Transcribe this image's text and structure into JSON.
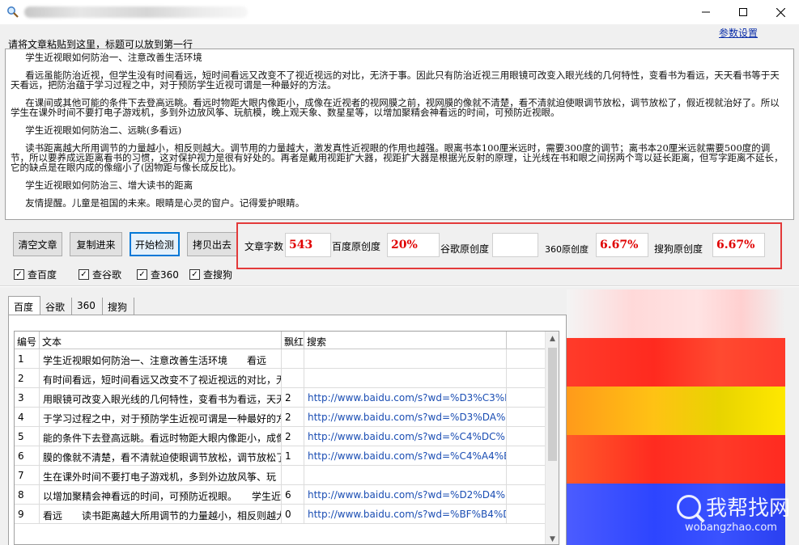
{
  "window": {
    "app_icon": "magnifier-icon",
    "min_label": "—",
    "max_label": "☐",
    "close_label": "✕"
  },
  "params_link": "参数设置",
  "paste_hint": "请将文章粘贴到这里，标题可以放到第一行",
  "article": {
    "p1": "     学生近视眼如何防治一、注意改善生活环境",
    "p2": "     看远虽能防治近视，但学生没有时间看远，短时间看远又改变不了视近视远的对比，无济于事。因此只有防治近视三用眼镜可改变入眼光线的几何特性，变看书为看远，天天看书等于天天看远，把防治蕴于学习过程之中，对于预防学生近视可谓是一种最好的方法。",
    "p3": "     在课间或其他可能的条件下去登高远眺。看远时物距大眼内像距小，成像在近视者的视网膜之前，视网膜的像就不清楚，看不清就迫使眼调节放松，调节放松了，假近视就治好了。所以学生在课外时间不要打电子游戏机，多到外边放风筝、玩航模，晚上观天象、数星星等，以增加聚精会神看远的时间，可预防近视眼。",
    "p4": "     学生近视眼如何防治二、远眺(多看远)",
    "p5": "     读书距离越大所用调节的力量越小，相反则越大。调节用的力量越大，激发真性近视眼的作用也越强。眼离书本100厘米远时，需要300度的调节；离书本20厘米远就需要500度的调节，所以要养成远距离看书的习惯，这对保护视力是很有好处的。再者是戴用视距扩大器，视距扩大器是根据光反射的原理，让光线在书和眼之间拐两个弯以延长距离，但写字距离不延长，它的缺点是在眼内成的像缩小了(因物距与像长成反比)。",
    "p6": "     学生近视眼如何防治三、增大读书的距离",
    "p7": "     友情提醒。儿童是祖国的未来。眼睛是心灵的窗户。记得爱护眼睛。"
  },
  "buttons": {
    "clear": "清空文章",
    "copy_in": "复制进来",
    "start": "开始检测",
    "copy_out": "拷贝出去"
  },
  "stats": {
    "word_count_label": "文章字数",
    "word_count": "543",
    "baidu_label": "百度原创度",
    "baidu": "20%",
    "google_label": "谷歌原创度",
    "google": "",
    "s360_label": "360原创度",
    "s360": "6.67%",
    "sogou_label": "搜狗原创度",
    "sogou": "6.67%",
    "highlight_color": "#e33a3a"
  },
  "checks": [
    {
      "label": "查百度",
      "checked": true
    },
    {
      "label": "查谷歌",
      "checked": true
    },
    {
      "label": "查360",
      "checked": true
    },
    {
      "label": "查搜狗",
      "checked": true
    }
  ],
  "tabs": [
    "百度",
    "谷歌",
    "360",
    "搜狗"
  ],
  "grid": {
    "headers": [
      "编号",
      "文本",
      "飘红",
      "搜索"
    ],
    "rows": [
      {
        "no": "1",
        "text": "      学生近视眼如何防治一、注意改善生活环境　　看远",
        "red": "",
        "url": ""
      },
      {
        "no": "2",
        "text": "有时间看远，短时间看远又改变不了视近视远的对比，无",
        "red": "",
        "url": ""
      },
      {
        "no": "3",
        "text": "用眼镜可改变入眼光线的几何特性，变看书为看远，天天",
        "red": "2",
        "url": "http://www.baidu.com/s?wd=%D3%C3%D"
      },
      {
        "no": "4",
        "text": "于学习过程之中，对于预防学生近视可谓是一种最好的方",
        "red": "2",
        "url": "http://www.baidu.com/s?wd=%D3%DA%D"
      },
      {
        "no": "5",
        "text": "能的条件下去登高远眺。看远时物距大眼内像距小，成像",
        "red": "2",
        "url": "http://www.baidu.com/s?wd=%C4%DC%B"
      },
      {
        "no": "6",
        "text": "膜的像就不清楚，看不清就迫使眼调节放松，调节放松了",
        "red": "1",
        "url": "http://www.baidu.com/s?wd=%C4%A4%B"
      },
      {
        "no": "7",
        "text": "生在课外时间不要打电子游戏机，多到外边放风筝、玩",
        "red": "",
        "url": ""
      },
      {
        "no": "8",
        "text": "以增加聚精会神看远的时间，可预防近视眼。　　学生近",
        "red": "6",
        "url": "http://www.baidu.com/s?wd=%D2%D4%D"
      },
      {
        "no": "9",
        "text": "看远　　读书距离越大所用调节的力量越小，相反则越大",
        "red": "0",
        "url": "http://www.baidu.com/s?wd=%BF%B4%D"
      }
    ]
  },
  "watermark": {
    "cn": "我帮找网",
    "en": "wobangzhao.com"
  }
}
